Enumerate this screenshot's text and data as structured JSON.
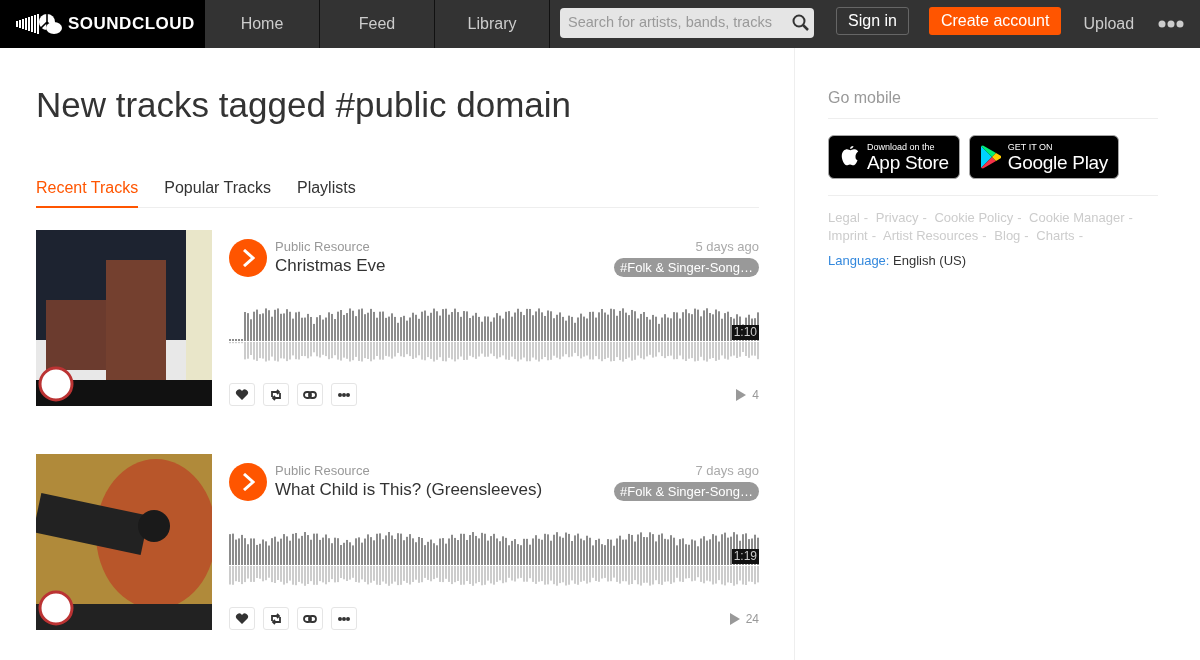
{
  "navbar": {
    "logo": "SOUNDCLOUD",
    "links": [
      {
        "label": "Home"
      },
      {
        "label": "Feed"
      },
      {
        "label": "Library"
      }
    ],
    "search": {
      "placeholder": "Search for artists, bands, tracks"
    },
    "sign_in": "Sign in",
    "create_account": "Create account",
    "upload": "Upload"
  },
  "heading": "New tracks tagged #public domain",
  "tabs": [
    {
      "label": "Recent Tracks",
      "selected": true
    },
    {
      "label": "Popular Tracks",
      "selected": false
    },
    {
      "label": "Playlists",
      "selected": false
    }
  ],
  "tracks": [
    {
      "kind": "church",
      "user": "Public Resource",
      "title": "Christmas Eve",
      "posted": "5 days ago",
      "tag": "#Folk & Singer-Song…",
      "duration": "1:10",
      "plays": "4"
    },
    {
      "kind": "guitar",
      "user": "Public Resource",
      "title": "What Child is This? (Greensleeves)",
      "posted": "7 days ago",
      "tag": "#Folk & Singer-Song…",
      "duration": "1:19",
      "plays": "24"
    }
  ],
  "sidebar": {
    "heading": "Go mobile",
    "stores": [
      {
        "kind": "apple",
        "small": "Download on the",
        "big": "App Store"
      },
      {
        "kind": "google",
        "small": "GET IT ON",
        "big": "Google Play"
      }
    ],
    "links": [
      {
        "label": "Legal",
        "sep": "-"
      },
      {
        "label": "Privacy",
        "sep": "-"
      },
      {
        "label": "Cookie Policy",
        "sep": "-"
      },
      {
        "label": "Cookie Manager",
        "sep": "-"
      },
      {
        "label": "Imprint",
        "sep": "-"
      },
      {
        "label": "Artist Resources",
        "sep": "-"
      },
      {
        "label": "Blog",
        "sep": "-"
      },
      {
        "label": "Charts",
        "sep": "-"
      }
    ],
    "language_label": "Language:",
    "language": "English (US)"
  }
}
